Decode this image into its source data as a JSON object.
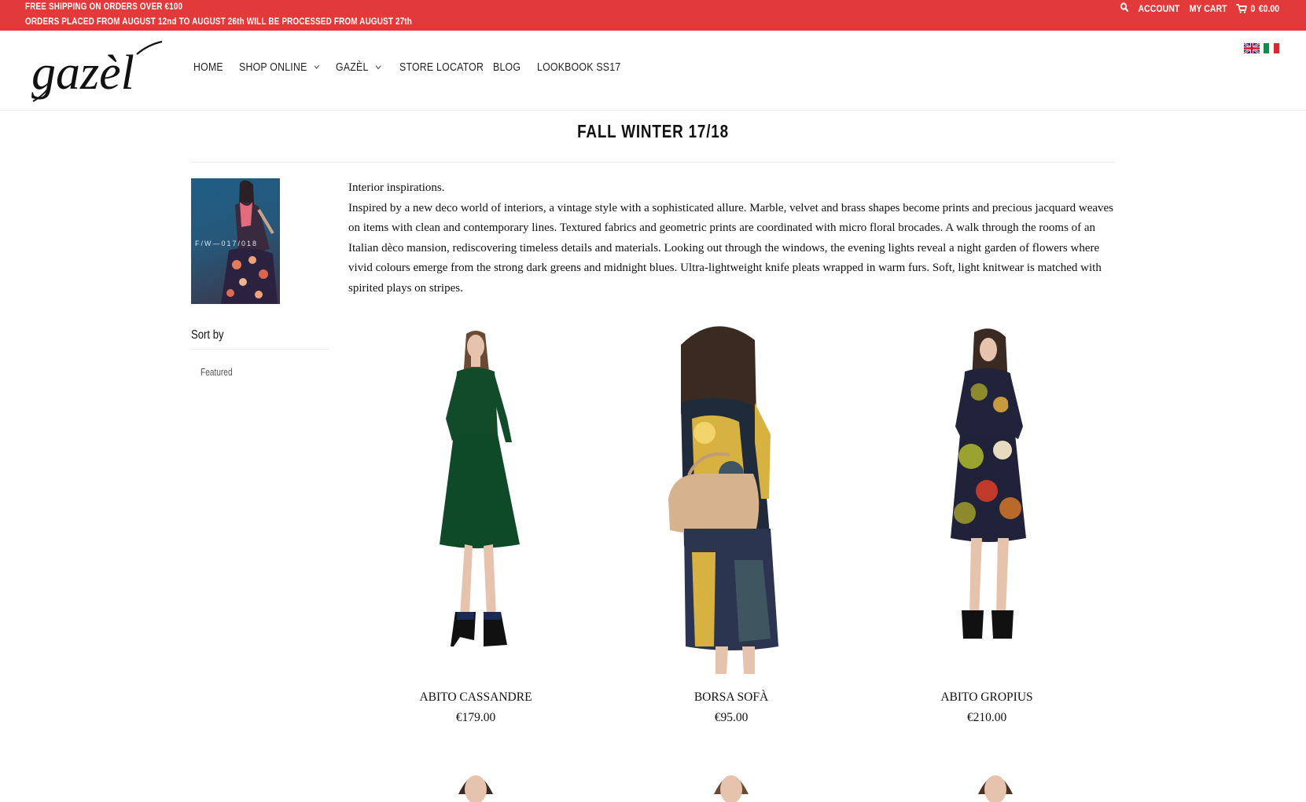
{
  "announcement": {
    "line1": "FREE SHIPPING ON ORDERS OVER €100",
    "line2": "ORDERS PLACED FROM AUGUST 12nd TO AUGUST 26th WILL BE PROCESSED FROM AUGUST 27th",
    "background_color": "#e23a3a"
  },
  "utility": {
    "search_icon": "search-icon",
    "account_label": "ACCOUNT",
    "cart_label": "MY CART",
    "cart_icon": "cart-icon",
    "cart_count": "0",
    "cart_total": "€0.00"
  },
  "brand": {
    "logo_text": "gazèl"
  },
  "nav": {
    "items": [
      {
        "label": "HOME",
        "has_dropdown": false
      },
      {
        "label": "SHOP ONLINE",
        "has_dropdown": true
      },
      {
        "label": "GAZÈL",
        "has_dropdown": true
      },
      {
        "label": "STORE LOCATOR",
        "has_dropdown": false
      },
      {
        "label": "BLOG",
        "has_dropdown": false
      },
      {
        "label": "LOOKBOOK SS17",
        "has_dropdown": false
      }
    ]
  },
  "languages": [
    {
      "icon": "uk-flag-icon"
    },
    {
      "icon": "italy-flag-icon"
    }
  ],
  "page": {
    "title": "FALL WINTER 17/18",
    "thumb_caption": "F/W—017/018",
    "description_line1": "Interior inspirations.",
    "description_body": "Inspired by a new deco world of interiors, a vintage style with a sophisticated allure. Marble, velvet and brass shapes become prints and precious jacquard weaves on items with clean and contemporary lines. Textured fabrics and geometric prints are coordinated with micro floral brocades. A walk through the rooms of an Italian dèco mansion, rediscovering timeless details and materials. Looking out through the windows, the evening lights reveal a night garden of flowers where vivid colours emerge from the strong dark greens and midnight blues. Ultra-lightweight knife pleats wrapped in warm furs. Soft, light knitwear is matched with spirited plays on stripes."
  },
  "sidebar": {
    "sort_title": "Sort by",
    "sort_options": [
      "Featured"
    ]
  },
  "products": [
    {
      "name": "ABITO CASSANDRE",
      "price": "€179.00"
    },
    {
      "name": "BORSA SOFÀ",
      "price": "€95.00"
    },
    {
      "name": "ABITO GROPIUS",
      "price": "€210.00"
    }
  ]
}
